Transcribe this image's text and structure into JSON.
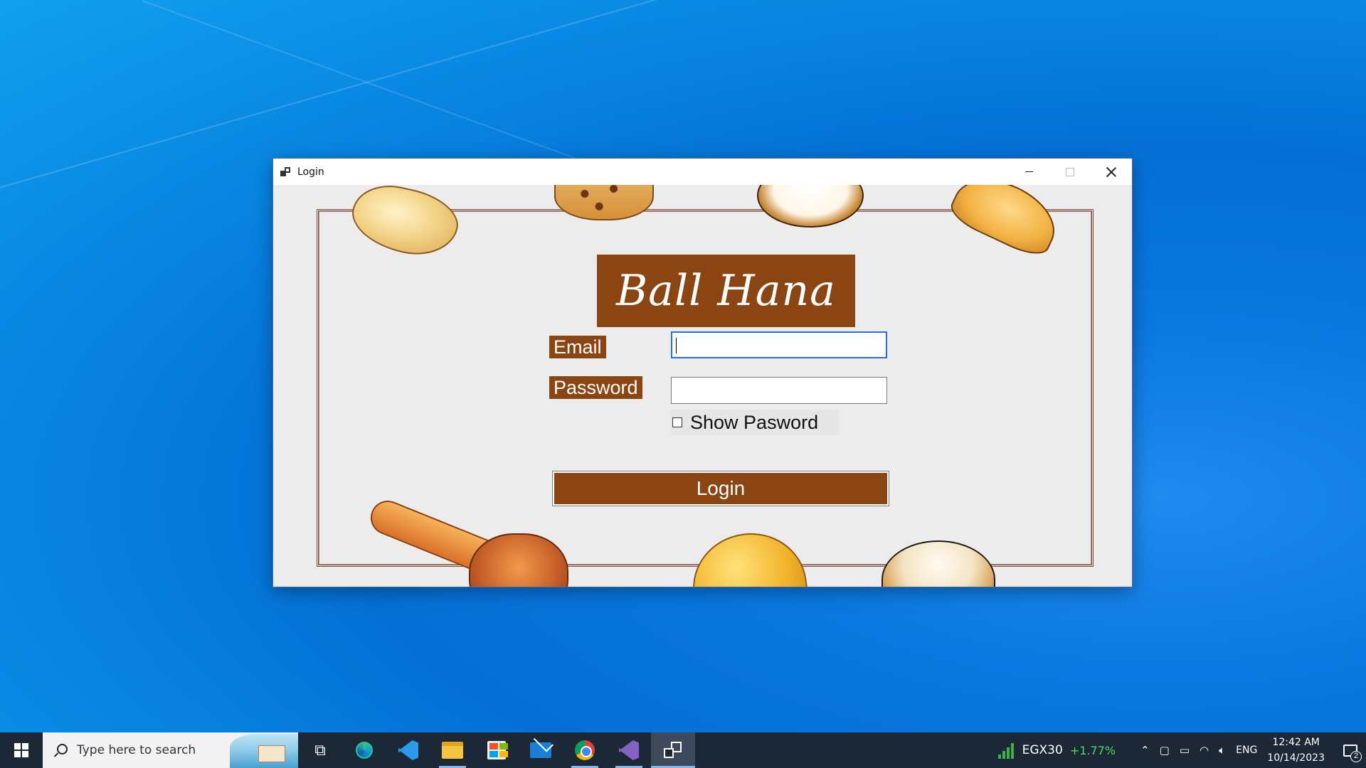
{
  "window": {
    "title": "Login",
    "brand": "Ball Hana",
    "email_label": "Email",
    "email_value": "",
    "password_label": "Password",
    "password_value": "",
    "show_password_label": "Show Pasword",
    "show_password_checked": false,
    "login_label": "Login"
  },
  "taskbar": {
    "search_placeholder": "Type here to search",
    "apps": [
      "task-view",
      "edge",
      "vscode",
      "file-explorer",
      "store",
      "mail",
      "chrome",
      "visual-studio",
      "login-form"
    ],
    "stock_name": "EGX30",
    "stock_change": "+1.77%",
    "language": "ENG",
    "time": "12:42 AM",
    "date": "10/14/2023",
    "notification_count": "2"
  },
  "colors": {
    "brand_brown": "#8b4513",
    "desktop_blue": "#0a78e0",
    "taskbar": "#1c2836",
    "stock_green": "#4cd964"
  }
}
